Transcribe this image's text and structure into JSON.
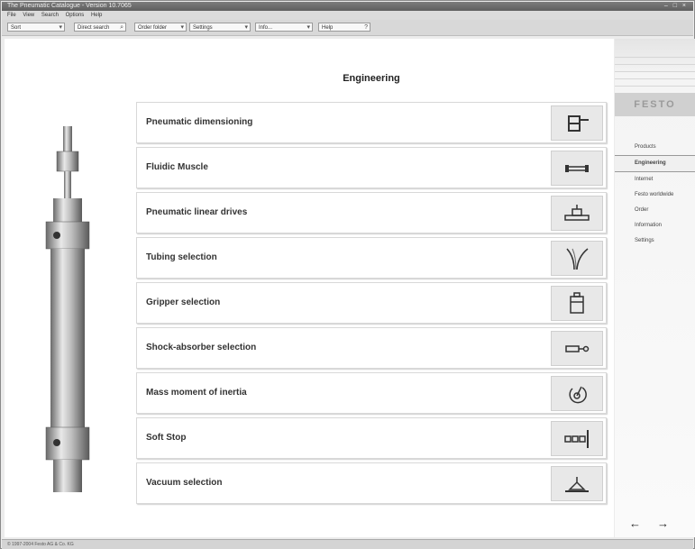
{
  "window": {
    "title": "The Pneumatic Catalogue - Version 10.7065",
    "controls": "– □ ×"
  },
  "menu": [
    "File",
    "View",
    "Search",
    "Options",
    "Help"
  ],
  "toolbar": [
    {
      "label": "Sort",
      "icon": "▾"
    },
    {
      "label": "Direct search",
      "icon": "⌕"
    },
    {
      "label": "Order folder",
      "icon": "▾"
    },
    {
      "label": "Settings",
      "icon": "▾"
    },
    {
      "label": "Info...",
      "icon": "▾"
    },
    {
      "label": "Help",
      "icon": "?"
    }
  ],
  "main": {
    "title": "Engineering",
    "items": [
      {
        "label": "Pneumatic dimensioning",
        "icon": "dimensioning-icon"
      },
      {
        "label": "Fluidic Muscle",
        "icon": "fluidic-muscle-icon"
      },
      {
        "label": "Pneumatic linear drives",
        "icon": "linear-drive-icon"
      },
      {
        "label": "Tubing selection",
        "icon": "tubing-icon"
      },
      {
        "label": "Gripper selection",
        "icon": "gripper-icon"
      },
      {
        "label": "Shock-absorber selection",
        "icon": "shock-absorber-icon"
      },
      {
        "label": "Mass moment of inertia",
        "icon": "inertia-icon"
      },
      {
        "label": "Soft Stop",
        "icon": "soft-stop-icon"
      },
      {
        "label": "Vacuum selection",
        "icon": "vacuum-icon"
      }
    ]
  },
  "sidebar": {
    "logo": "FESTO",
    "items": [
      {
        "label": "Products",
        "active": false
      },
      {
        "label": "Engineering",
        "active": true
      },
      {
        "label": "Internet",
        "active": false
      },
      {
        "label": "Festo worldwide",
        "active": false
      },
      {
        "label": "Order",
        "active": false
      },
      {
        "label": "Information",
        "active": false
      },
      {
        "label": "Settings",
        "active": false
      }
    ]
  },
  "nav_arrows": {
    "back": "←",
    "forward": "→"
  },
  "status": "© 1997-2004 Festo AG & Co. KG"
}
